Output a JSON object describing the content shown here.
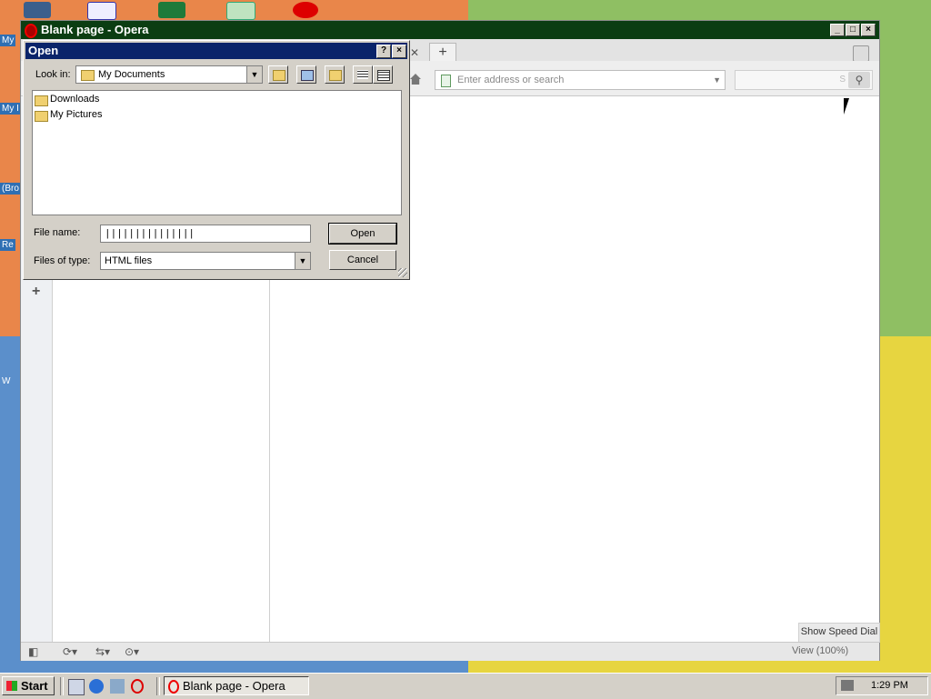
{
  "desktop": {
    "labels": [
      "My",
      "My I",
      "(Bro",
      "Re",
      "W"
    ]
  },
  "opera": {
    "title": "Blank page - Opera",
    "address_placeholder": "Enter address or search",
    "search_letter": "S",
    "speed_dial": "Show Speed Dial",
    "zoom": "View (100%)"
  },
  "dialog": {
    "title": "Open",
    "help": "?",
    "close": "×",
    "look_in_label": "Look in:",
    "look_in_value": "My Documents",
    "files": [
      {
        "name": "Downloads"
      },
      {
        "name": "My Pictures"
      }
    ],
    "file_name_label": "File name:",
    "file_name_value": "|||||||||||||||",
    "file_type_label": "Files of type:",
    "file_type_value": "HTML files",
    "open_button": "Open",
    "cancel_button": "Cancel"
  },
  "taskbar": {
    "start": "Start",
    "task": "Blank page - Opera",
    "clock": "1:29 PM"
  },
  "colors": {
    "opera_title": "#0b3d12",
    "dialog_title": "#0a246a",
    "win_face": "#d4d0c8"
  }
}
